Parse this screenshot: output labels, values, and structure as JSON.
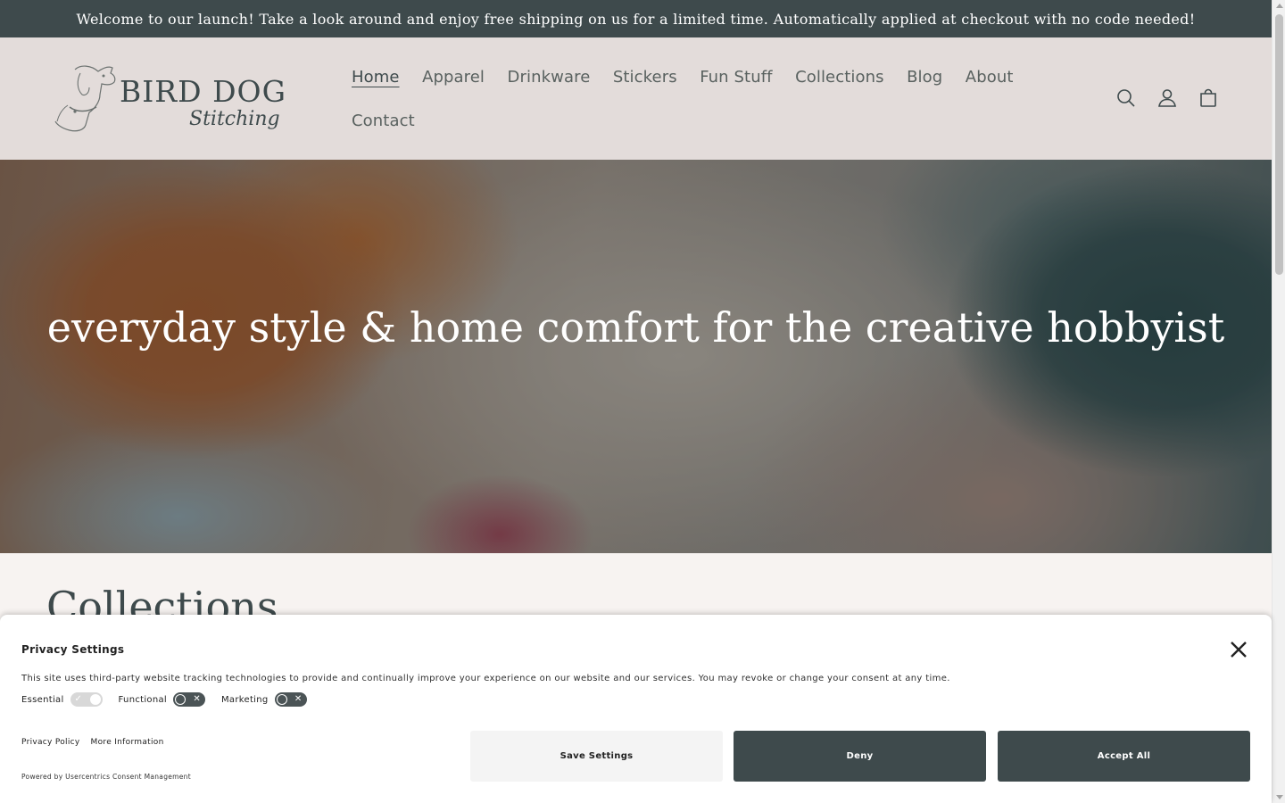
{
  "announcement": {
    "text": "Welcome to our launch! Take a look around and enjoy free shipping on us for a limited time. Automatically applied at checkout with no code needed!"
  },
  "header": {
    "logo": {
      "line1": "BIRD DOG",
      "line2": "Stitching"
    },
    "nav": [
      {
        "label": "Home",
        "active": true
      },
      {
        "label": "Apparel"
      },
      {
        "label": "Drinkware"
      },
      {
        "label": "Stickers"
      },
      {
        "label": "Fun Stuff"
      },
      {
        "label": "Collections"
      },
      {
        "label": "Blog"
      },
      {
        "label": "About"
      },
      {
        "label": "Contact"
      }
    ],
    "icons": [
      "search-icon",
      "account-icon",
      "cart-icon"
    ]
  },
  "hero": {
    "title": "everyday style & home comfort for the creative hobbyist"
  },
  "collections": {
    "heading": "Collections"
  },
  "consent": {
    "title": "Privacy Settings",
    "description": "This site uses third-party website tracking technologies to provide and continually improve your experience on our website and our services. You may revoke or change your consent at any time.",
    "toggles": [
      {
        "label": "Essential",
        "state": "on"
      },
      {
        "label": "Functional",
        "state": "off"
      },
      {
        "label": "Marketing",
        "state": "off"
      }
    ],
    "links": [
      "Privacy Policy",
      "More Information"
    ],
    "powered_by": "Powered by Usercentrics Consent Management",
    "buttons": {
      "save": "Save Settings",
      "deny": "Deny",
      "accept": "Accept All"
    }
  },
  "colors": {
    "brand_dark": "#3e4a4c",
    "header_bg": "#e3dcda",
    "page_bg": "#f7f3f1"
  }
}
